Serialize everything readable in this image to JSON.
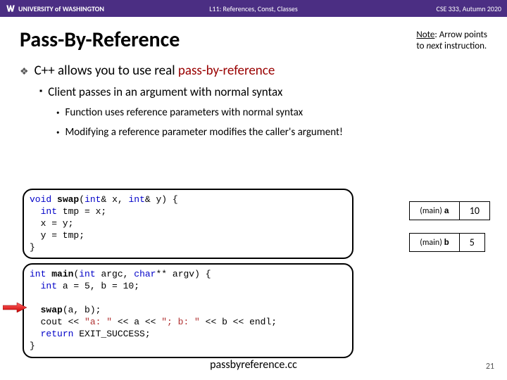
{
  "topbar": {
    "brand": "UNIVERSITY of WASHINGTON",
    "center": "L11: References, Const, Classes",
    "right": "CSE 333, Autumn 2020"
  },
  "title": "Pass-By-Reference",
  "note": {
    "line1_prefix": "Note",
    "line1_rest": ": Arrow points",
    "line2_prefix": "to ",
    "line2_em": "next",
    "line2_rest": " instruction."
  },
  "bullets": {
    "b1_prefix": "C++ allows you to use real ",
    "b1_ref": "pass-by-reference",
    "b2": "Client passes in an argument with normal syntax",
    "b3a": "Function uses reference parameters with normal syntax",
    "b3b": "Modifying a reference parameter modifies the caller's argument!"
  },
  "code1": "void swap(int& x, int& y) {\n  int tmp = x;\n  x = y;\n  y = tmp;\n}",
  "code2": "int main(int argc, char** argv) {\n  int a = 5, b = 10;\n\n  swap(a, b);\n  cout << \"a: \" << a << \"; b: \" << b << endl;\n  return EXIT_SUCCESS;\n}",
  "vars": {
    "a_label_scope": "(main)",
    "a_label_name": "a",
    "a_value": "10",
    "b_label_scope": "(main)",
    "b_label_name": "b",
    "b_value": "5"
  },
  "filename": "passbyreference.cc",
  "page": "21"
}
